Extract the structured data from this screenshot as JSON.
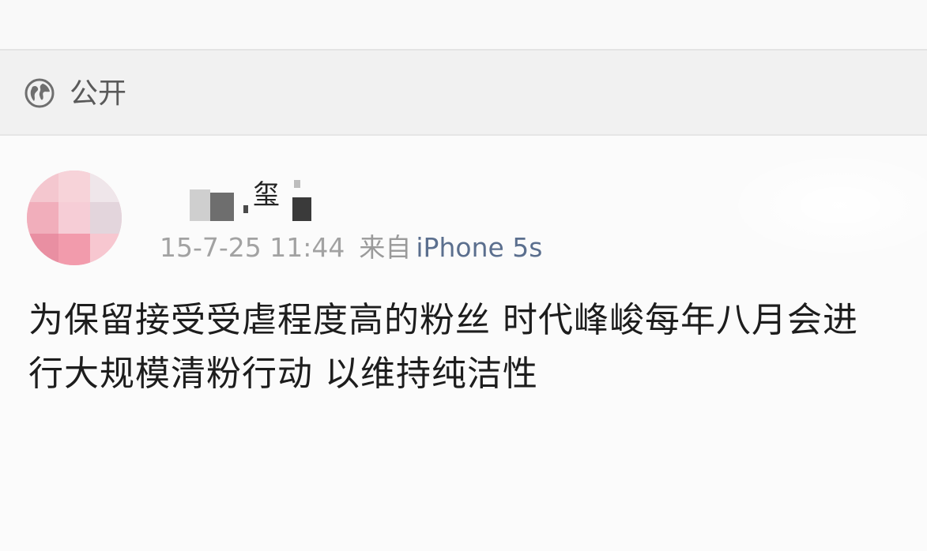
{
  "visibility": {
    "icon": "globe-icon",
    "label": "公开"
  },
  "post": {
    "author_visible_char": "玺",
    "time": "15-7-25 11:44",
    "source_prefix": "来自",
    "device": "iPhone 5s",
    "text_lines": [
      "为保留接受受虐程度高的粉丝  时代峰峻每年八月会进",
      "行大规模清粉行动 以维持纯洁性"
    ]
  },
  "colors": {
    "link_blue": "#5b6f8e",
    "meta_gray": "#a2a2a2",
    "avatar_pink": "#f2b8c2"
  }
}
